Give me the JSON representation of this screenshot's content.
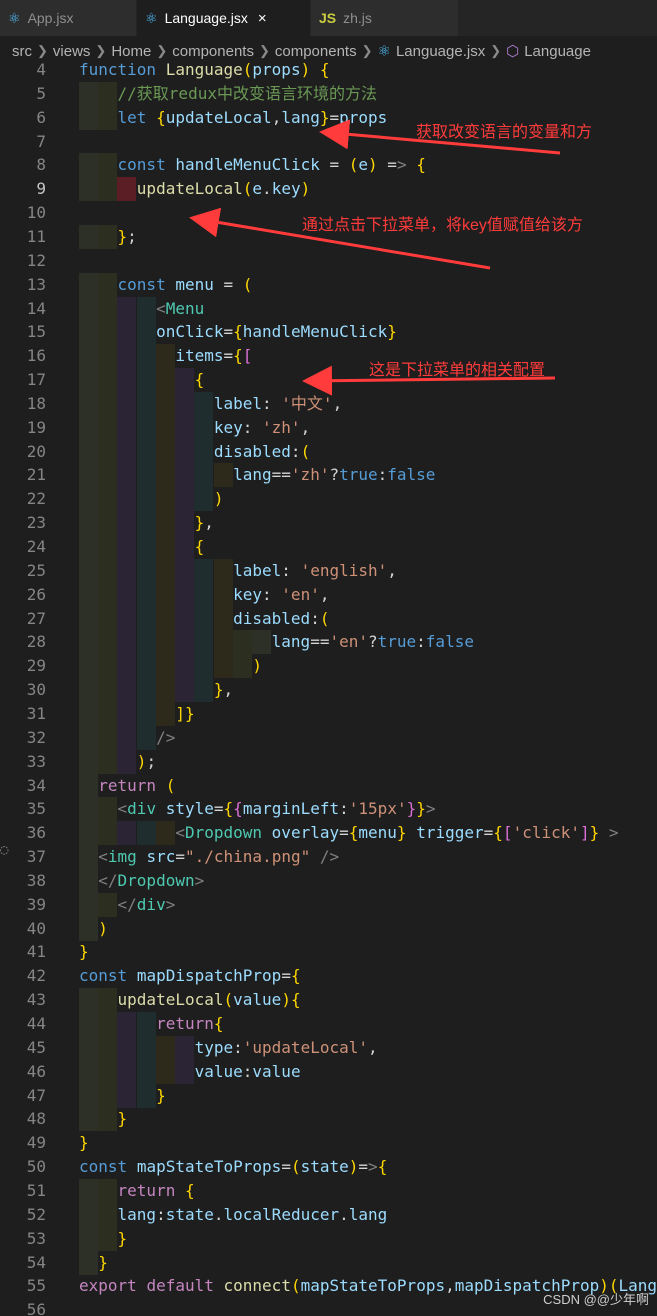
{
  "tabs": [
    {
      "label": "App.jsx",
      "icon": "react-icon",
      "active": false
    },
    {
      "label": "Language.jsx",
      "icon": "react-icon",
      "active": true
    },
    {
      "label": "zh.js",
      "icon": "js-icon",
      "active": false
    }
  ],
  "tab_close": "×",
  "js_badge": "JS",
  "breadcrumb": [
    "src",
    "views",
    "Home",
    "components",
    "components",
    "Language.jsx",
    "Language"
  ],
  "annotations": {
    "a1": "获取改变语言的变量和方",
    "a2": "通过点击下拉菜单，将key值赋值给该方",
    "a3": "这是下拉菜单的相关配置"
  },
  "watermark": "CSDN @@少年啊",
  "lines": [
    {
      "n": 4,
      "code": "function Language(props) {"
    },
    {
      "n": 5,
      "code": "    //获取redux中改变语言环境的方法"
    },
    {
      "n": 6,
      "code": "    let {updateLocal,lang}=props"
    },
    {
      "n": 7,
      "code": ""
    },
    {
      "n": 8,
      "code": "    const handleMenuClick = (e) => {"
    },
    {
      "n": 9,
      "code": "      updateLocal(e.key)"
    },
    {
      "n": 10,
      "code": ""
    },
    {
      "n": 11,
      "code": "    };"
    },
    {
      "n": 12,
      "code": ""
    },
    {
      "n": 13,
      "code": "    const menu = ("
    },
    {
      "n": 14,
      "code": "        <Menu"
    },
    {
      "n": 15,
      "code": "        onClick={handleMenuClick}"
    },
    {
      "n": 16,
      "code": "          items={["
    },
    {
      "n": 17,
      "code": "            {"
    },
    {
      "n": 18,
      "code": "              label: '中文',"
    },
    {
      "n": 19,
      "code": "              key: 'zh',"
    },
    {
      "n": 20,
      "code": "              disabled:("
    },
    {
      "n": 21,
      "code": "                lang=='zh'?true:false"
    },
    {
      "n": 22,
      "code": "              )"
    },
    {
      "n": 23,
      "code": "            },"
    },
    {
      "n": 24,
      "code": "            {"
    },
    {
      "n": 25,
      "code": "                label: 'english',"
    },
    {
      "n": 26,
      "code": "                key: 'en',"
    },
    {
      "n": 27,
      "code": "                disabled:("
    },
    {
      "n": 28,
      "code": "                    lang=='en'?true:false"
    },
    {
      "n": 29,
      "code": "                  )"
    },
    {
      "n": 30,
      "code": "              },"
    },
    {
      "n": 31,
      "code": "          ]}"
    },
    {
      "n": 32,
      "code": "        />"
    },
    {
      "n": 33,
      "code": "      );"
    },
    {
      "n": 34,
      "code": "  return ("
    },
    {
      "n": 35,
      "code": "    <div style={{marginLeft:'15px'}}>"
    },
    {
      "n": 36,
      "code": "          <Dropdown overlay={menu} trigger={['click']} >"
    },
    {
      "n": 37,
      "code": "  <img src=\"./china.png\" />"
    },
    {
      "n": 38,
      "code": "  </Dropdown>"
    },
    {
      "n": 39,
      "code": "    </div>"
    },
    {
      "n": 40,
      "code": "  )"
    },
    {
      "n": 41,
      "code": "}"
    },
    {
      "n": 42,
      "code": "const mapDispatchProp={"
    },
    {
      "n": 43,
      "code": "    updateLocal(value){"
    },
    {
      "n": 44,
      "code": "        return{"
    },
    {
      "n": 45,
      "code": "            type:'updateLocal',"
    },
    {
      "n": 46,
      "code": "            value:value"
    },
    {
      "n": 47,
      "code": "        }"
    },
    {
      "n": 48,
      "code": "    }"
    },
    {
      "n": 49,
      "code": "}"
    },
    {
      "n": 50,
      "code": "const mapStateToProps=(state)=>{"
    },
    {
      "n": 51,
      "code": "    return {"
    },
    {
      "n": 52,
      "code": "    lang:state.localReducer.lang"
    },
    {
      "n": 53,
      "code": "    }"
    },
    {
      "n": 54,
      "code": "  }"
    },
    {
      "n": 55,
      "code": "export default connect(mapStateToProps,mapDispatchProp)(Language)"
    },
    {
      "n": 56,
      "code": ""
    }
  ],
  "colors": {
    "annotation": "#ff3b3b",
    "background": "#1e1e1e",
    "keyword": "#569cd6"
  }
}
